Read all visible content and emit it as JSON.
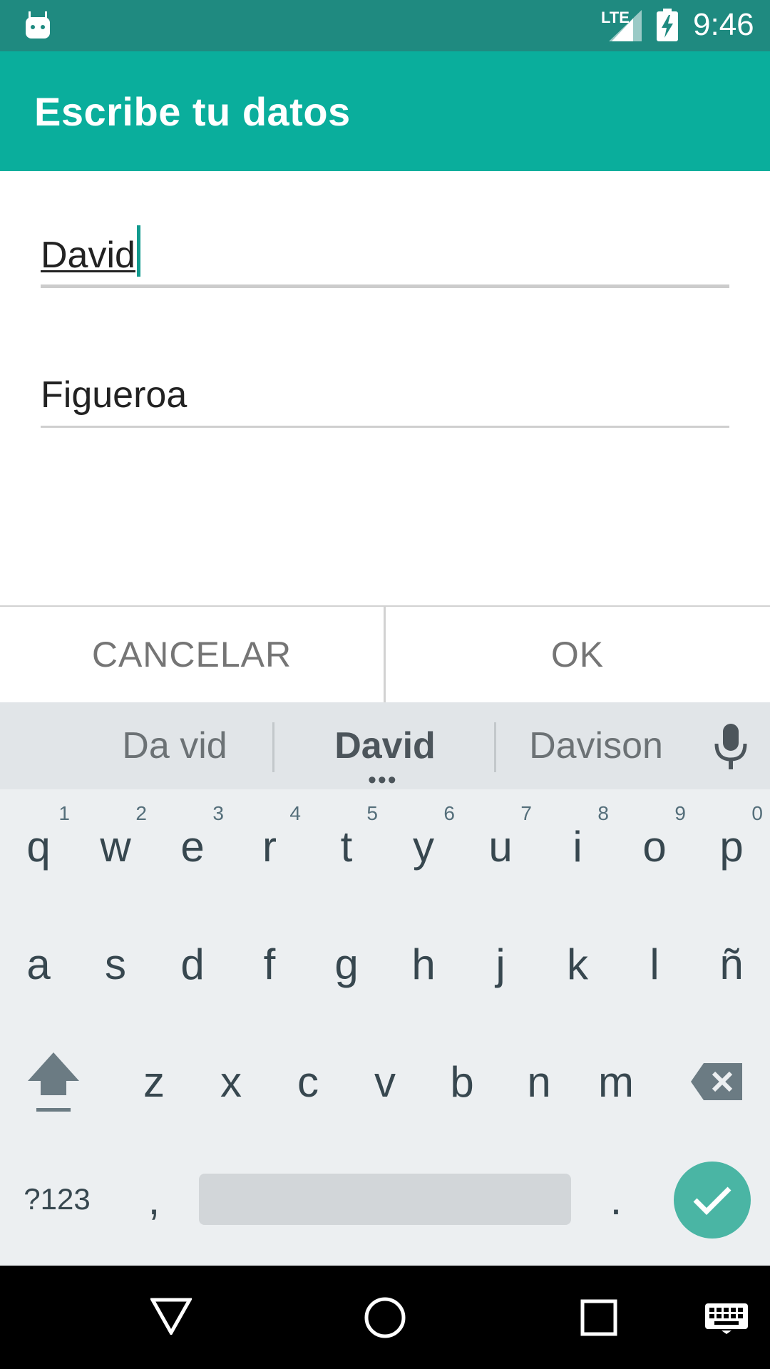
{
  "status_bar": {
    "network": "LTE",
    "time": "9:46"
  },
  "app_bar": {
    "title": "Escribe tu datos"
  },
  "form": {
    "first_name": "David",
    "last_name": "Figueroa"
  },
  "dialog": {
    "cancel_label": "CANCELAR",
    "ok_label": "OK"
  },
  "keyboard": {
    "suggestions": [
      "Da vid",
      "David",
      "Davison"
    ],
    "row1": [
      {
        "key": "q",
        "hint": "1"
      },
      {
        "key": "w",
        "hint": "2"
      },
      {
        "key": "e",
        "hint": "3"
      },
      {
        "key": "r",
        "hint": "4"
      },
      {
        "key": "t",
        "hint": "5"
      },
      {
        "key": "y",
        "hint": "6"
      },
      {
        "key": "u",
        "hint": "7"
      },
      {
        "key": "i",
        "hint": "8"
      },
      {
        "key": "o",
        "hint": "9"
      },
      {
        "key": "p",
        "hint": "0"
      }
    ],
    "row2": [
      "a",
      "s",
      "d",
      "f",
      "g",
      "h",
      "j",
      "k",
      "l",
      "ñ"
    ],
    "row3": [
      "z",
      "x",
      "c",
      "v",
      "b",
      "n",
      "m"
    ],
    "symbols_label": "?123",
    "comma": ",",
    "period": "."
  },
  "colors": {
    "status_bar": "#1f8a80",
    "app_bar": "#0aae9c",
    "accent": "#4ab5a4",
    "keyboard_bg": "#eceff1"
  },
  "icons": [
    "android-icon",
    "signal-icon",
    "battery-charging-icon",
    "mic-icon",
    "shift-icon",
    "backspace-icon",
    "check-icon",
    "back-icon",
    "home-icon",
    "recents-icon",
    "keyboard-icon"
  ]
}
